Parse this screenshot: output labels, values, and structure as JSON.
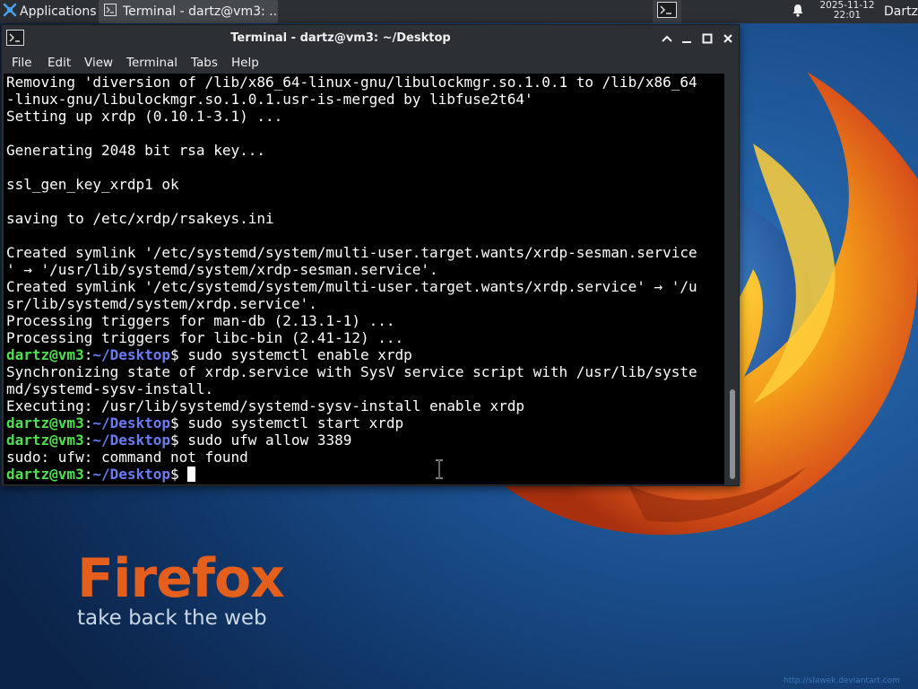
{
  "colors": {
    "panel_bg": "#2c2f33",
    "terminal_bg": "#000000",
    "prompt_user": "#4ee04e",
    "prompt_path": "#6a7cf5",
    "wallpaper_accent": "#e45e1c"
  },
  "top_panel": {
    "applications_label": "Applications",
    "applications_icon": "xfce-mouse-icon",
    "task_terminal_label": "Terminal - dartz@vm3: ...",
    "clock_date": "2025-11-12",
    "clock_time": "22:01",
    "user_label": "Dartz",
    "notifications_icon": "bell-icon"
  },
  "window": {
    "title": "Terminal - dartz@vm3: ~/Desktop",
    "menu": [
      "File",
      "Edit",
      "View",
      "Terminal",
      "Tabs",
      "Help"
    ]
  },
  "terminal": {
    "lines": [
      {
        "text": "Removing 'diversion of /lib/x86_64-linux-gnu/libulockmgr.so.1.0.1 to /lib/x86_64"
      },
      {
        "text": "-linux-gnu/libulockmgr.so.1.0.1.usr-is-merged by libfuse2t64'"
      },
      {
        "text": "Setting up xrdp (0.10.1-3.1) ..."
      },
      {
        "text": ""
      },
      {
        "text": "Generating 2048 bit rsa key..."
      },
      {
        "text": ""
      },
      {
        "text": "ssl_gen_key_xrdp1 ok"
      },
      {
        "text": ""
      },
      {
        "text": "saving to /etc/xrdp/rsakeys.ini"
      },
      {
        "text": ""
      },
      {
        "text": "Created symlink '/etc/systemd/system/multi-user.target.wants/xrdp-sesman.service"
      },
      {
        "text": "' → '/usr/lib/systemd/system/xrdp-sesman.service'."
      },
      {
        "text": "Created symlink '/etc/systemd/system/multi-user.target.wants/xrdp.service' → '/u"
      },
      {
        "text": "sr/lib/systemd/system/xrdp.service'."
      },
      {
        "text": "Processing triggers for man-db (2.13.1-1) ..."
      },
      {
        "text": "Processing triggers for libc-bin (2.41-12) ..."
      },
      {
        "user": "dartz@vm3",
        "path": "~/Desktop",
        "cmd": " sudo systemctl enable xrdp"
      },
      {
        "text": "Synchronizing state of xrdp.service with SysV service script with /usr/lib/syste"
      },
      {
        "text": "md/systemd-sysv-install."
      },
      {
        "text": "Executing: /usr/lib/systemd/systemd-sysv-install enable xrdp"
      },
      {
        "user": "dartz@vm3",
        "path": "~/Desktop",
        "cmd": " sudo systemctl start xrdp"
      },
      {
        "user": "dartz@vm3",
        "path": "~/Desktop",
        "cmd": " sudo ufw allow 3389"
      },
      {
        "text": "sudo: ufw: command not found"
      },
      {
        "user": "dartz@vm3",
        "path": "~/Desktop",
        "cmd": " ",
        "cursor": true
      }
    ]
  },
  "wallpaper": {
    "title": "Firefox",
    "tagline": "take back the web",
    "credit": "http://slawek.deviantart.com"
  }
}
